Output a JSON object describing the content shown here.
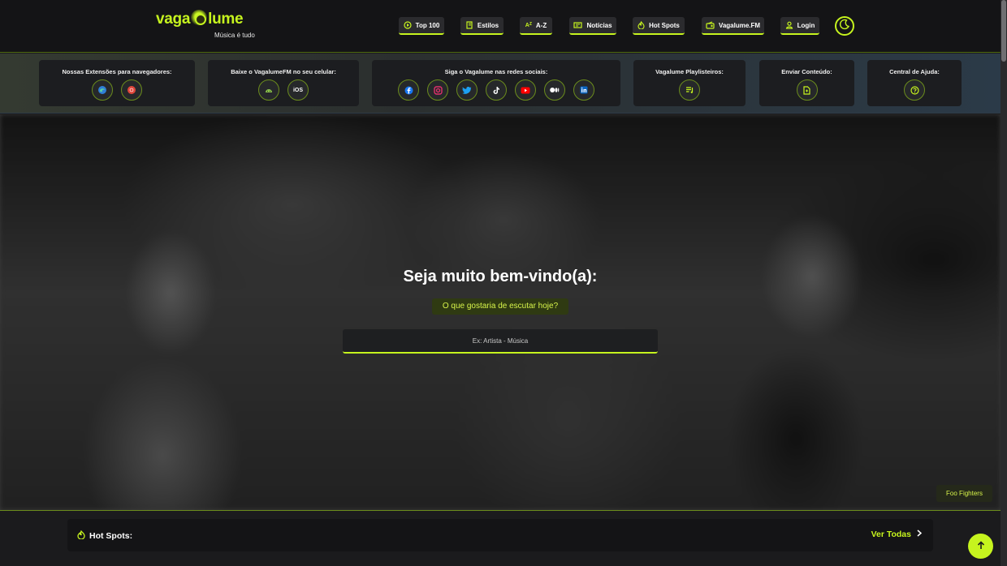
{
  "header": {
    "logo_left": "vaga",
    "logo_right": "lume",
    "tagline": "Música é tudo",
    "nav": [
      {
        "label": "Top 100",
        "icon": "play-circle-icon"
      },
      {
        "label": "Estilos",
        "icon": "book-icon"
      },
      {
        "label": "A-Z",
        "icon": "sort-az-icon"
      },
      {
        "label": "Notícias",
        "icon": "newspaper-icon"
      },
      {
        "label": "Hot Spots",
        "icon": "flame-icon"
      },
      {
        "label": "Vagalume.FM",
        "icon": "radio-icon"
      },
      {
        "label": "Login",
        "icon": "user-icon"
      }
    ],
    "theme_toggle": "moon-icon"
  },
  "banner": {
    "extensions": {
      "title": "Nossas Extensões para navegadores:",
      "icons": [
        "edge-icon",
        "chrome-icon"
      ]
    },
    "app": {
      "title": "Baixe o VagalumeFM no seu celular:",
      "icons": [
        "android-icon"
      ],
      "ios_label": "iOS"
    },
    "social": {
      "title": "Siga o Vagalume nas redes sociais:",
      "icons": [
        "facebook-icon",
        "instagram-icon",
        "twitter-icon",
        "tiktok-icon",
        "youtube-icon",
        "medium-icon",
        "linkedin-icon"
      ]
    },
    "playlists": {
      "title": "Vagalume Playlisteiros:",
      "icons": [
        "playlist-icon"
      ]
    },
    "submit": {
      "title": "Enviar Conteúdo:",
      "icons": [
        "document-icon"
      ]
    },
    "help": {
      "title": "Central de Ajuda:",
      "icons": [
        "help-icon"
      ]
    }
  },
  "hero": {
    "title": "Seja muito bem-vindo(a):",
    "subtitle": "O que gostaria de escutar hoje?",
    "search_placeholder": "Ex: Artista - Música",
    "photo_credit": "Foo Fighters"
  },
  "hot_spots": {
    "title": "Hot Spots:",
    "see_all": "Ver Todas"
  },
  "colors": {
    "accent": "#c6f41e",
    "background": "#1b1b1d",
    "header": "#141416"
  }
}
